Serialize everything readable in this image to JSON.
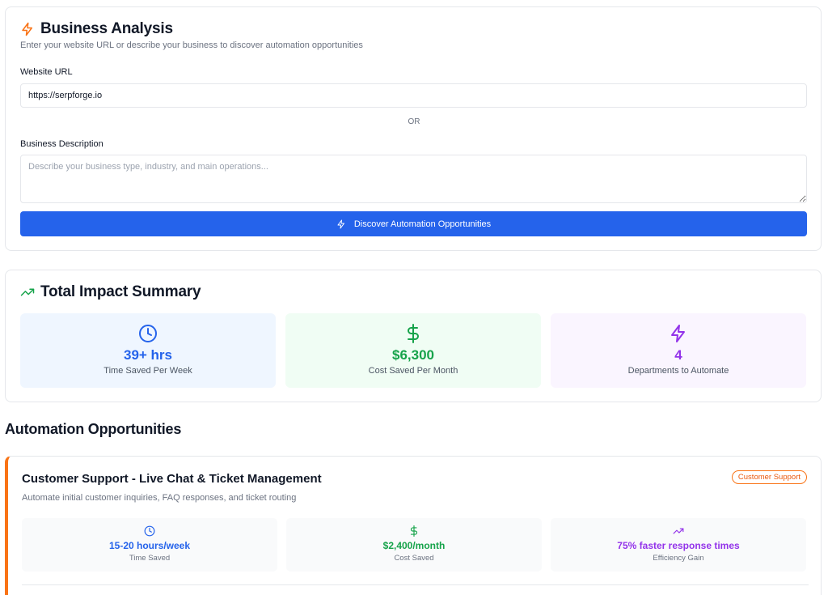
{
  "analysis": {
    "title": "Business Analysis",
    "subtitle": "Enter your website URL or describe your business to discover automation opportunities",
    "website_label": "Website URL",
    "website_value": "https://serpforge.io",
    "or_text": "OR",
    "description_label": "Business Description",
    "description_placeholder": "Describe your business type, industry, and main operations...",
    "button_label": "Discover Automation Opportunities"
  },
  "impact": {
    "title": "Total Impact Summary",
    "stats": [
      {
        "value": "39+ hrs",
        "label": "Time Saved Per Week",
        "icon": "clock-icon",
        "color": "#2563eb",
        "bg": "#eff6ff"
      },
      {
        "value": "$6,300",
        "label": "Cost Saved Per Month",
        "icon": "dollar-icon",
        "color": "#16a34a",
        "bg": "#f0fdf4"
      },
      {
        "value": "4",
        "label": "Departments to Automate",
        "icon": "zap-icon",
        "color": "#9333ea",
        "bg": "#faf5ff"
      }
    ]
  },
  "opportunities": {
    "heading": "Automation Opportunities",
    "items": [
      {
        "title": "Customer Support - Live Chat & Ticket Management",
        "badge": "Customer Support",
        "description": "Automate initial customer inquiries, FAQ responses, and ticket routing",
        "accent": "#f97316",
        "metrics": [
          {
            "value": "15-20 hours/week",
            "label": "Time Saved",
            "icon": "clock-icon",
            "color": "#2563eb"
          },
          {
            "value": "$2,400/month",
            "label": "Cost Saved",
            "icon": "dollar-icon",
            "color": "#16a34a"
          },
          {
            "value": "75% faster response times",
            "label": "Efficiency Gain",
            "icon": "trending-up-icon",
            "color": "#9333ea"
          }
        ]
      }
    ]
  },
  "colors": {
    "primary": "#2563eb",
    "accent_orange": "#f97316",
    "green": "#16a34a",
    "purple": "#9333ea"
  }
}
